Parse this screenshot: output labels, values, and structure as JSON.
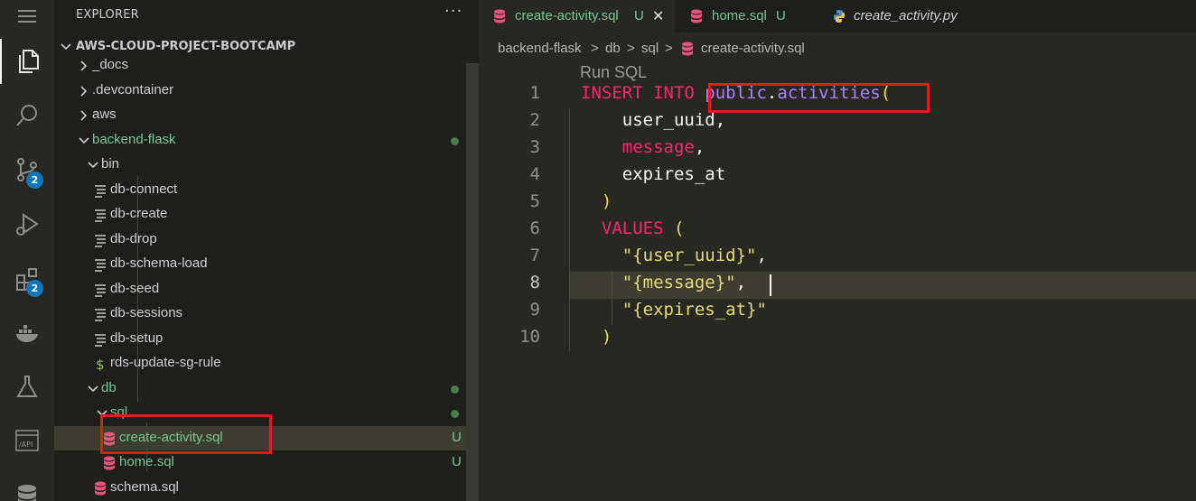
{
  "sidebar": {
    "title": "EXPLORER",
    "more": "···",
    "project": "AWS-CLOUD-PROJECT-BOOTCAMP",
    "items": [
      {
        "label": "_docs",
        "kind": "folder-closed",
        "depth": 1
      },
      {
        "label": ".devcontainer",
        "kind": "folder-closed",
        "depth": 1
      },
      {
        "label": "aws",
        "kind": "folder-closed",
        "depth": 1
      },
      {
        "label": "backend-flask",
        "kind": "folder-open",
        "depth": 1,
        "status": "dot",
        "green": true
      },
      {
        "label": "bin",
        "kind": "folder-open",
        "depth": 2
      },
      {
        "label": "db-connect",
        "kind": "file-text",
        "depth": 3
      },
      {
        "label": "db-create",
        "kind": "file-text",
        "depth": 3
      },
      {
        "label": "db-drop",
        "kind": "file-text",
        "depth": 3
      },
      {
        "label": "db-schema-load",
        "kind": "file-text",
        "depth": 3
      },
      {
        "label": "db-seed",
        "kind": "file-text",
        "depth": 3
      },
      {
        "label": "db-sessions",
        "kind": "file-text",
        "depth": 3
      },
      {
        "label": "db-setup",
        "kind": "file-text",
        "depth": 3
      },
      {
        "label": "rds-update-sg-rule",
        "kind": "file-shell",
        "depth": 3
      },
      {
        "label": "db",
        "kind": "folder-open",
        "depth": 2,
        "status": "dot",
        "green": true
      },
      {
        "label": "sql",
        "kind": "folder-open",
        "depth": 3,
        "status": "dot",
        "green": true
      },
      {
        "label": "create-activity.sql",
        "kind": "file-db",
        "depth": 4,
        "status": "U",
        "green": true,
        "selected": true
      },
      {
        "label": "home.sql",
        "kind": "file-db",
        "depth": 4,
        "status": "U",
        "green": true
      },
      {
        "label": "schema.sql",
        "kind": "file-db",
        "depth": 3
      }
    ]
  },
  "activity_bar": {
    "items": [
      {
        "name": "menu-icon"
      },
      {
        "name": "explorer-icon",
        "active": true
      },
      {
        "name": "search-icon"
      },
      {
        "name": "source-control-icon",
        "badge": "2"
      },
      {
        "name": "run-debug-icon"
      },
      {
        "name": "extensions-icon",
        "badge": "2"
      },
      {
        "name": "docker-icon"
      },
      {
        "name": "testing-icon"
      },
      {
        "name": "api-icon",
        "text": "/API"
      },
      {
        "name": "database-icon"
      }
    ]
  },
  "tabs": [
    {
      "label": "create-activity.sql",
      "status": "U",
      "active": true,
      "close": "✕",
      "icon": "db"
    },
    {
      "label": "home.sql",
      "status": "U",
      "active": false,
      "icon": "db"
    },
    {
      "label": "create_activity.py",
      "active": false,
      "icon": "python",
      "italic": true
    }
  ],
  "breadcrumb": [
    "backend-flask",
    "db",
    "sql",
    "create-activity.sql"
  ],
  "breadcrumb_sep": ">",
  "editor": {
    "codelens": "Run SQL",
    "current_line": 8,
    "lines": [
      {
        "n": "1",
        "parts": [
          {
            "t": "INSERT INTO ",
            "c": "k"
          },
          {
            "t": "public",
            "c": "p"
          },
          {
            "t": ".",
            "c": "w"
          },
          {
            "t": "activities",
            "c": "p"
          },
          {
            "t": "(",
            "c": "br"
          }
        ]
      },
      {
        "n": "2",
        "parts": [
          {
            "t": "    user_uuid,",
            "c": "w"
          }
        ]
      },
      {
        "n": "3",
        "parts": [
          {
            "t": "    ",
            "c": "w"
          },
          {
            "t": "message",
            "c": "k"
          },
          {
            "t": ",",
            "c": "w"
          }
        ]
      },
      {
        "n": "4",
        "parts": [
          {
            "t": "    expires_at",
            "c": "w"
          }
        ]
      },
      {
        "n": "5",
        "parts": [
          {
            "t": "  ",
            "c": "w"
          },
          {
            "t": ")",
            "c": "br"
          }
        ]
      },
      {
        "n": "6",
        "parts": [
          {
            "t": "  ",
            "c": "w"
          },
          {
            "t": "VALUES ",
            "c": "k"
          },
          {
            "t": "(",
            "c": "br"
          }
        ]
      },
      {
        "n": "7",
        "parts": [
          {
            "t": "    ",
            "c": "w"
          },
          {
            "t": "\"{user_uuid}\"",
            "c": "y"
          },
          {
            "t": ",",
            "c": "w"
          }
        ]
      },
      {
        "n": "8",
        "parts": [
          {
            "t": "    ",
            "c": "w"
          },
          {
            "t": "\"{message}\"",
            "c": "y"
          },
          {
            "t": ",",
            "c": "w"
          }
        ]
      },
      {
        "n": "9",
        "parts": [
          {
            "t": "    ",
            "c": "w"
          },
          {
            "t": "\"{expires_at}\"",
            "c": "y"
          }
        ]
      },
      {
        "n": "10",
        "parts": [
          {
            "t": "  ",
            "c": "w"
          },
          {
            "t": ")",
            "c": "br"
          }
        ]
      }
    ]
  },
  "colors": {
    "keyword": "#f92672",
    "identifier": "#ae81ff",
    "string": "#e6db74",
    "git_untracked": "#73c991",
    "highlight_box": "#e21b1b"
  }
}
